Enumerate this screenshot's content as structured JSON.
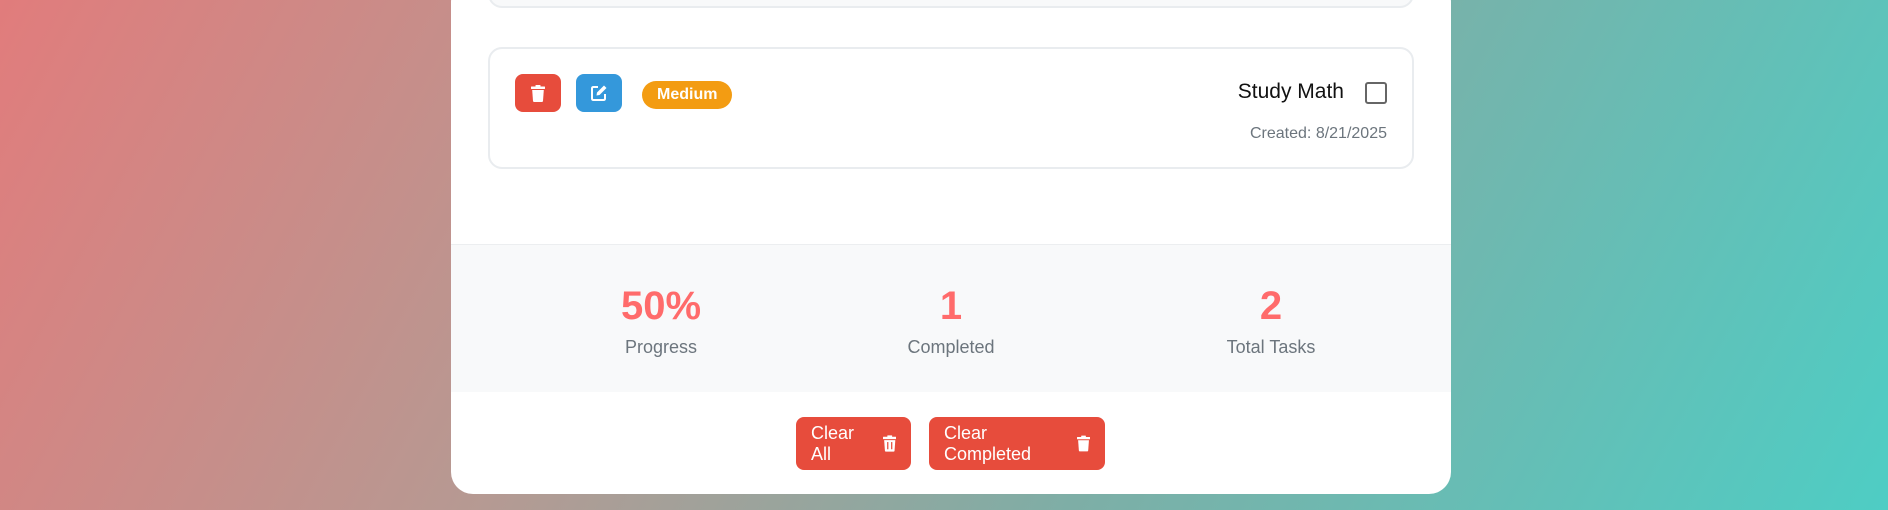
{
  "task": {
    "priority": "Medium",
    "title": "Study Math",
    "created": "Created: 8/21/2025",
    "completed": false,
    "delete_icon": "trash-icon",
    "edit_icon": "edit-icon"
  },
  "stats": [
    {
      "value": "50%",
      "label": "Progress"
    },
    {
      "value": "1",
      "label": "Completed"
    },
    {
      "value": "2",
      "label": "Total Tasks"
    }
  ],
  "actions": {
    "clear_all": "Clear All",
    "clear_completed": "Clear Completed"
  },
  "colors": {
    "delete": "#e74c3c",
    "edit": "#3498db",
    "priority_medium": "#f39c12",
    "stat_number": "#ff6b6b"
  }
}
